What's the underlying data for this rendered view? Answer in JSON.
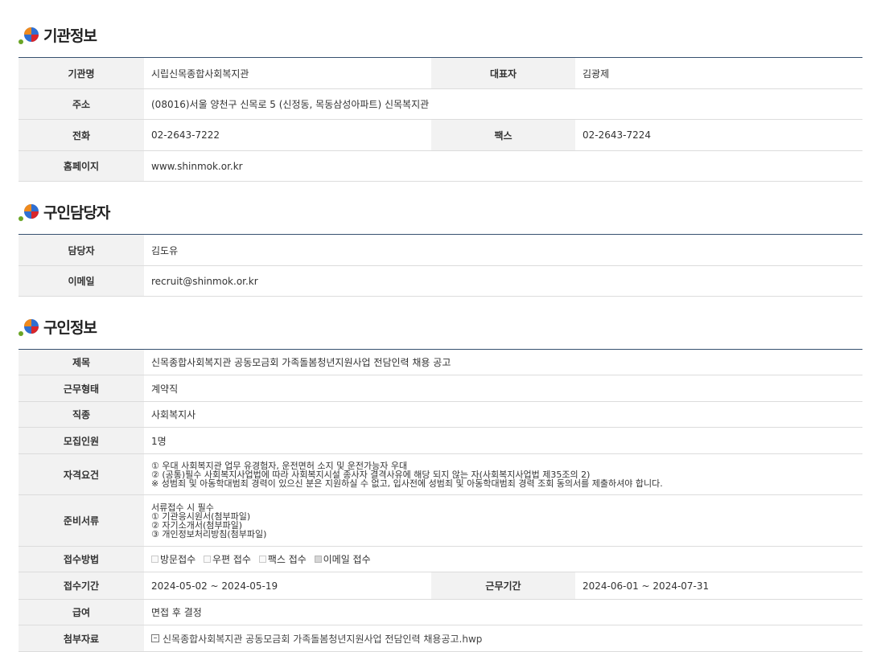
{
  "org": {
    "title": "기관정보",
    "name_label": "기관명",
    "name_value": "시립신목종합사회복지관",
    "rep_label": "대표자",
    "rep_value": "김광제",
    "address_label": "주소",
    "address_value": "(08016)서울 양천구 신목로 5 (신정동, 목동삼성아파트) 신목복지관",
    "phone_label": "전화",
    "phone_value": "02-2643-7222",
    "fax_label": "팩스",
    "fax_value": "02-2643-7224",
    "homepage_label": "홈페이지",
    "homepage_value": "www.shinmok.or.kr"
  },
  "contact": {
    "title": "구인담당자",
    "person_label": "담당자",
    "person_value": "김도유",
    "email_label": "이메일",
    "email_value": "recruit@shinmok.or.kr"
  },
  "job": {
    "title": "구인정보",
    "subject_label": "제목",
    "subject_value": "신목종합사회복지관 공동모금회 가족돌봄청년지원사업 전담인력 채용 공고",
    "worktype_label": "근무형태",
    "worktype_value": "계약직",
    "position_label": "직종",
    "position_value": "사회복지사",
    "headcount_label": "모집인원",
    "headcount_value": "1명",
    "qual_label": "자격요건",
    "qual_lines": [
      "① 우대 사회복지관 업무 유경험자, 운전면허 소지 및 운전가능자 우대",
      "② (공통)필수 사회복지사업법에 따라 사회복지시설 종사자 결격사유에 해당      되지 않는 자(사회복지사업법 제35조의 2)",
      "※ 성범죄 및 아동학대범죄 경력이 있으신 분은 지원하실 수 없고, 입사전에 성범죄 및 아동학대범죄 경력 조회 동의서를 제출하셔야 합니다."
    ],
    "docs_label": "준비서류",
    "docs_lines": [
      "서류접수 시 필수",
      "① 기관응시원서(첨부파일)",
      "② 자기소개서(첨부파일)",
      "③ 개인정보처리방침(첨부파일)"
    ],
    "method_label": "접수방법",
    "methods": [
      {
        "label": "방문접수",
        "checked": false
      },
      {
        "label": "우편 접수",
        "checked": false
      },
      {
        "label": "팩스 접수",
        "checked": false
      },
      {
        "label": "이메일 접수",
        "checked": true
      }
    ],
    "apply_period_label": "접수기간",
    "apply_period_value": "2024-05-02 ~ 2024-05-19",
    "work_period_label": "근무기간",
    "work_period_value": "2024-06-01 ~ 2024-07-31",
    "salary_label": "급여",
    "salary_value": "면접 후 결정",
    "attach_label": "첨부자료",
    "attach_value": "신목종합사회복지관 공동모금회 가족돌봄청년지원사업 전담인력 채용공고.hwp"
  },
  "colors": {
    "header_bg": "#f2f2f2",
    "table_top_border": "#36506f",
    "icon_blue": "#2f6fd1",
    "icon_orange": "#f08a1c",
    "icon_red": "#d9262b",
    "icon_green": "#6aa526"
  }
}
